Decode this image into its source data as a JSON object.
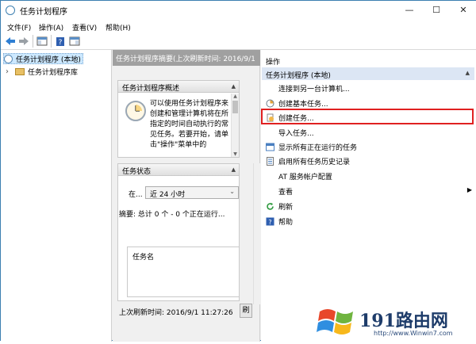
{
  "window": {
    "title": "任务计划程序",
    "minimize_glyph": "—",
    "maximize_glyph": "☐",
    "close_glyph": "✕"
  },
  "menu": [
    {
      "label": "文件(F)"
    },
    {
      "label": "操作(A)"
    },
    {
      "label": "查看(V)"
    },
    {
      "label": "帮助(H)"
    }
  ],
  "tree": {
    "root_label": "任务计划程序 (本地)",
    "child_label": "任务计划程序库",
    "expand_glyph": "›"
  },
  "middle": {
    "header": "任务计划程序摘要(上次刷新时间: 2016/9/1",
    "overview_title": "任务计划程序概述",
    "overview_text": "可以使用任务计划程序来创建和管理计算机将在所指定的时间自动执行的常见任务。若要开始，请单击\"操作\"菜单中的",
    "status_title": "任务状态",
    "status_period_label": "在...",
    "status_period_value": "近 24 小时",
    "summary_text": "摘要: 总计 0 个 - 0 个正在运行...",
    "tasks_column": "任务名",
    "last_refresh": "上次刷新时间: 2016/9/1 11:27:26",
    "refresh_button": "刷"
  },
  "actions": {
    "panel_title": "操作",
    "group_title": "任务计划程序 (本地)",
    "items": [
      {
        "label": "连接到另一台计算机...",
        "icon": "none"
      },
      {
        "label": "创建基本任务...",
        "icon": "basic-task-icon"
      },
      {
        "label": "创建任务...",
        "icon": "create-task-icon"
      },
      {
        "label": "导入任务...",
        "icon": "none"
      },
      {
        "label": "显示所有正在运行的任务",
        "icon": "running-tasks-icon"
      },
      {
        "label": "启用所有任务历史记录",
        "icon": "history-icon"
      },
      {
        "label": "AT 服务帐户配置",
        "icon": "none"
      },
      {
        "label": "查看",
        "icon": "none",
        "submenu": true
      },
      {
        "label": "刷新",
        "icon": "refresh-icon"
      },
      {
        "label": "帮助",
        "icon": "help-icon"
      }
    ]
  },
  "watermark": {
    "brand": "191路由网",
    "url": "http://www.Winwin7.com"
  },
  "colors": {
    "highlight_border": "#e02020",
    "actions_group_bg": "#dce6f4",
    "header_gray": "#a0a0a0"
  }
}
